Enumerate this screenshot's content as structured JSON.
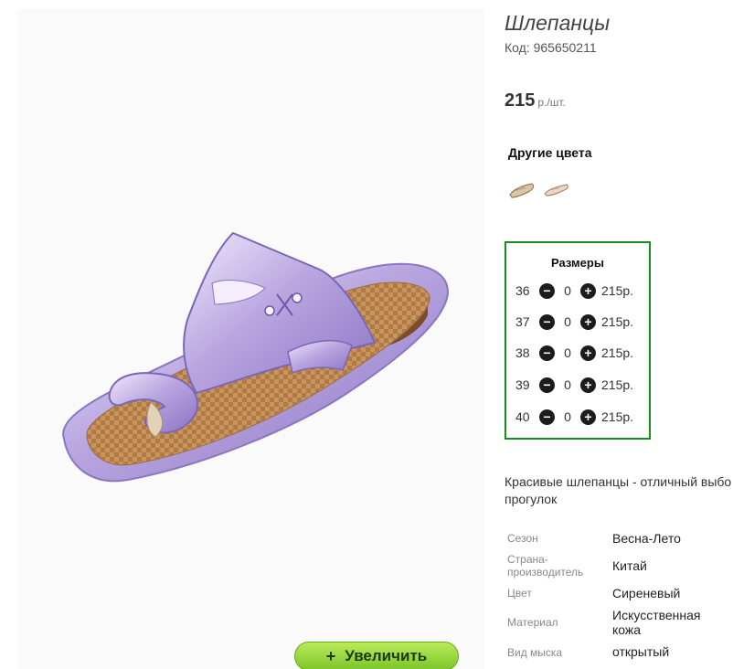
{
  "product": {
    "title": "Шлепанцы",
    "code": "Код: 965650211",
    "price": "215",
    "price_unit": "р./шт.",
    "other_colors_label": "Другие цвета",
    "zoom_label": "Увеличить",
    "zoom_icon": "+"
  },
  "sizes": {
    "title": "Размеры",
    "rows": [
      {
        "size": "36",
        "qty": "0",
        "price": "215р."
      },
      {
        "size": "37",
        "qty": "0",
        "price": "215р."
      },
      {
        "size": "38",
        "qty": "0",
        "price": "215р."
      },
      {
        "size": "39",
        "qty": "0",
        "price": "215р."
      },
      {
        "size": "40",
        "qty": "0",
        "price": "215р."
      }
    ]
  },
  "description": {
    "line1": "Красивые шлепанцы - отличный выбо",
    "line2": "прогулок"
  },
  "attributes": [
    {
      "label_line1": "Сезон",
      "label_line2": "",
      "value_line1": "Весна-Лето",
      "value_line2": ""
    },
    {
      "label_line1": "Страна-",
      "label_line2": "производитель",
      "value_line1": "Китай",
      "value_line2": ""
    },
    {
      "label_line1": "Цвет",
      "label_line2": "",
      "value_line1": "Сиреневый",
      "value_line2": ""
    },
    {
      "label_line1": "Материал",
      "label_line2": "",
      "value_line1": "Искусственная",
      "value_line2": "кожа"
    },
    {
      "label_line1": "Вид мыска",
      "label_line2": "",
      "value_line1": "открытый",
      "value_line2": ""
    }
  ],
  "colors": {
    "sandal_metal": "#c9b8e8",
    "sole_cork": "#c89560",
    "frame_green": "#1c8a1c",
    "button_green": "#9ad843"
  },
  "icons": {
    "minus": "−",
    "plus": "+"
  }
}
